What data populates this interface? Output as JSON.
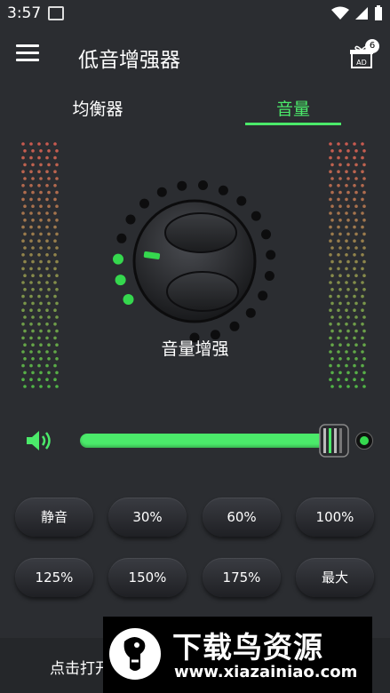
{
  "status": {
    "time": "3:57"
  },
  "app": {
    "title": "低音增强器",
    "ad_badge": "6",
    "ad_label": "AD"
  },
  "tabs": [
    {
      "label": "均衡器",
      "active": false
    },
    {
      "label": "音量",
      "active": true
    }
  ],
  "knob": {
    "label": "音量增强",
    "active_dots": 3,
    "total_dots": 20
  },
  "slider": {
    "value_fraction": 1.0
  },
  "presets": [
    {
      "label": "静音"
    },
    {
      "label": "30%"
    },
    {
      "label": "60%"
    },
    {
      "label": "100%"
    },
    {
      "label": "125%"
    },
    {
      "label": "150%"
    },
    {
      "label": "175%"
    },
    {
      "label": "最大"
    }
  ],
  "bottom": {
    "text": "点击打开"
  },
  "watermark": {
    "title": "下载鸟资源",
    "url": "www.xiazainiao.com"
  },
  "colors": {
    "background": "#2b2d31",
    "accent": "#4bea6a",
    "button": "#2c2e33"
  }
}
